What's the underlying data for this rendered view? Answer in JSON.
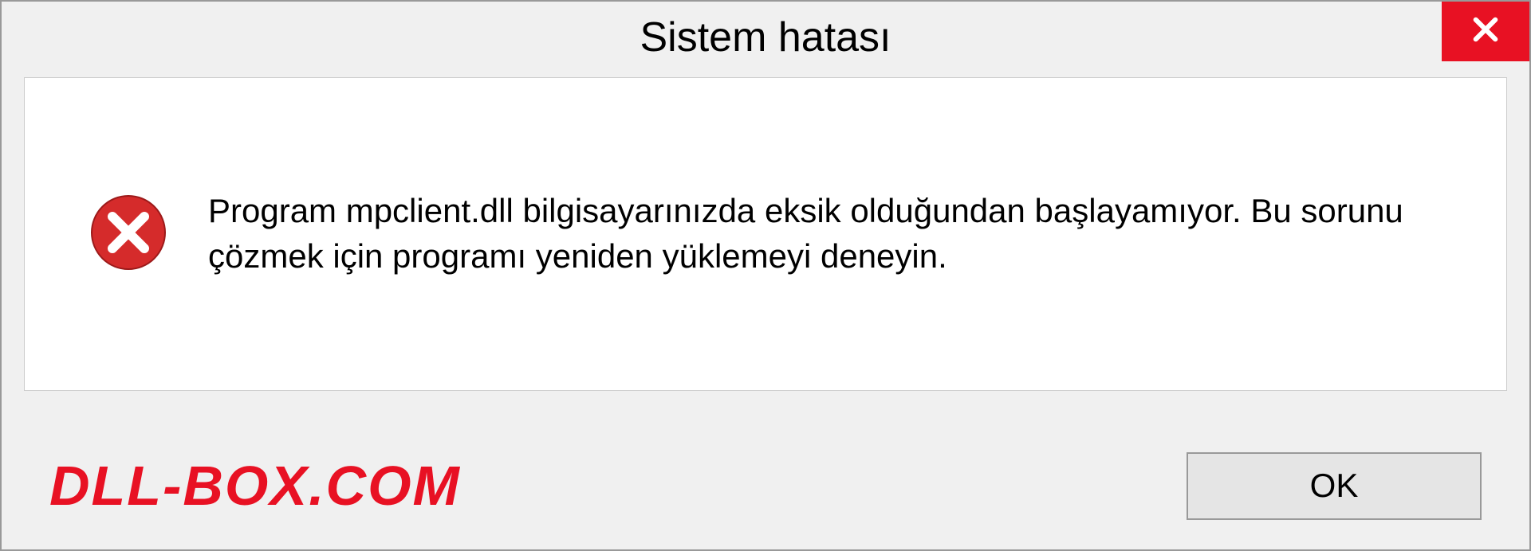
{
  "dialog": {
    "title": "Sistem hatası",
    "message": "Program mpclient.dll bilgisayarınızda eksik olduğundan başlayamıyor. Bu sorunu çözmek için programı yeniden yüklemeyi deneyin.",
    "ok_label": "OK"
  },
  "watermark": "DLL-BOX.COM",
  "colors": {
    "close_bg": "#e81123",
    "error_red": "#d52b2b"
  }
}
